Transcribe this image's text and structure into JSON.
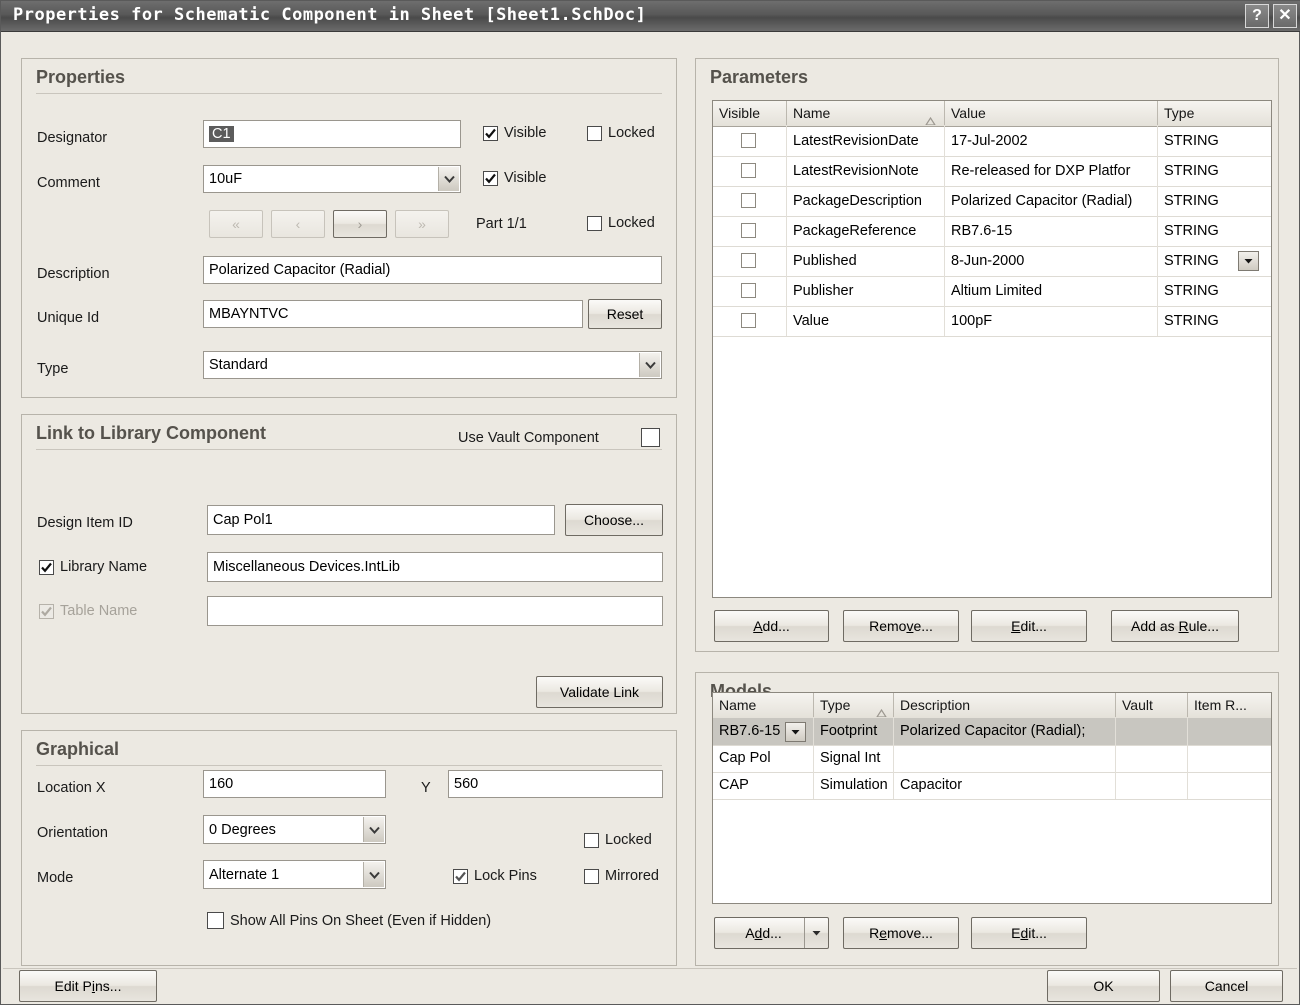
{
  "window": {
    "title": "Properties for Schematic Component in Sheet [Sheet1.SchDoc]",
    "help_button": "?",
    "close_button": "✕"
  },
  "properties": {
    "title": "Properties",
    "designator": {
      "label": "Designator",
      "value": "C1",
      "visible_label": "Visible",
      "visible_checked": true,
      "locked_label": "Locked",
      "locked_checked": false
    },
    "comment": {
      "label": "Comment",
      "value": "10uF",
      "visible_label": "Visible",
      "visible_checked": true
    },
    "nav": {
      "first": "«",
      "prev": "‹",
      "next": "›",
      "last": "»",
      "part_label": "Part 1/1",
      "locked_label": "Locked",
      "locked_checked": false
    },
    "description": {
      "label": "Description",
      "value": "Polarized Capacitor (Radial)"
    },
    "unique_id": {
      "label": "Unique Id",
      "value": "MBAYNTVC",
      "reset_button": "Reset"
    },
    "type": {
      "label": "Type",
      "value": "Standard"
    }
  },
  "link_library": {
    "title": "Link to Library Component",
    "use_vault_label": "Use Vault Component",
    "use_vault_checked": false,
    "design_item_id": {
      "label": "Design Item ID",
      "value": "Cap Pol1",
      "choose_button": "Choose..."
    },
    "library_name": {
      "label": "Library Name",
      "checked": true,
      "value": "Miscellaneous Devices.IntLib"
    },
    "table_name": {
      "label": "Table Name",
      "checked": true,
      "disabled": true,
      "value": ""
    },
    "validate_button": "Validate Link"
  },
  "graphical": {
    "title": "Graphical",
    "location": {
      "label": "Location  X",
      "x_value": "160",
      "y_label": "Y",
      "y_value": "560"
    },
    "orientation": {
      "label": "Orientation",
      "value": "0 Degrees"
    },
    "mode": {
      "label": "Mode",
      "value": "Alternate 1"
    },
    "locked": {
      "label": "Locked",
      "checked": false
    },
    "lock_pins": {
      "label": "Lock Pins",
      "checked": true
    },
    "mirrored": {
      "label": "Mirrored",
      "checked": false
    },
    "show_all_pins": {
      "label": "Show All Pins On Sheet (Even if Hidden)",
      "checked": false
    }
  },
  "parameters": {
    "title": "Parameters",
    "columns": [
      "Visible",
      "Name",
      "Value",
      "Type"
    ],
    "sorted_column": "Name",
    "sort_direction": "asc",
    "rows": [
      {
        "visible": false,
        "name": "LatestRevisionDate",
        "value": "17-Jul-2002",
        "type": "STRING"
      },
      {
        "visible": false,
        "name": "LatestRevisionNote",
        "value": "Re-released for DXP Platfor",
        "type": "STRING"
      },
      {
        "visible": false,
        "name": "PackageDescription",
        "value": "Polarized Capacitor (Radial)",
        "type": "STRING"
      },
      {
        "visible": false,
        "name": "PackageReference",
        "value": "RB7.6-15",
        "type": "STRING"
      },
      {
        "visible": false,
        "name": "Published",
        "value": "8-Jun-2000",
        "type": "STRING",
        "has_dropdown": true
      },
      {
        "visible": false,
        "name": "Publisher",
        "value": "Altium Limited",
        "type": "STRING"
      },
      {
        "visible": false,
        "name": "Value",
        "value": "100pF",
        "type": "STRING"
      }
    ],
    "buttons": {
      "add": "Add...",
      "remove": "Remove...",
      "edit": "Edit...",
      "add_as_rule": "Add as Rule..."
    }
  },
  "models": {
    "title": "Models",
    "columns": [
      "Name",
      "Type",
      "Description",
      "Vault",
      "Item R..."
    ],
    "sorted_column": "Type",
    "sort_direction": "asc",
    "rows": [
      {
        "name": "RB7.6-15",
        "type": "Footprint",
        "description": "Polarized Capacitor (Radial);",
        "vault": "",
        "item_r": "",
        "selected": true,
        "has_dropdown": true
      },
      {
        "name": "Cap Pol",
        "type": "Signal Int",
        "description": "",
        "vault": "",
        "item_r": "",
        "selected": false
      },
      {
        "name": "CAP",
        "type": "Simulation",
        "description": "Capacitor",
        "vault": "",
        "item_r": "",
        "selected": false
      }
    ],
    "buttons": {
      "add": "Add...",
      "remove": "Remove...",
      "edit": "Edit..."
    }
  },
  "footer": {
    "edit_pins": "Edit Pins...",
    "ok": "OK",
    "cancel": "Cancel"
  }
}
